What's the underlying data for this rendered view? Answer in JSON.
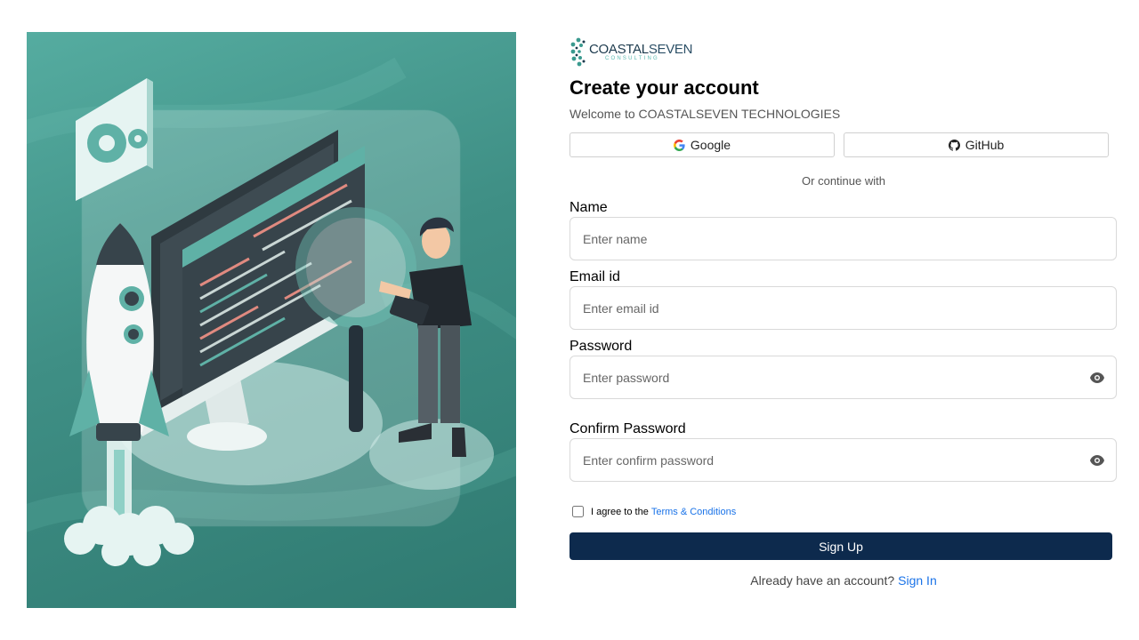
{
  "logo": {
    "main_bold": "COASTAL",
    "main_light": "SEVEN",
    "sub": "CONSULTING"
  },
  "header": {
    "title": "Create your account",
    "subtitle": "Welcome to COASTALSEVEN TECHNOLOGIES"
  },
  "social": {
    "google": "Google",
    "github": "GitHub"
  },
  "divider_text": "Or continue with",
  "fields": {
    "name": {
      "label": "Name",
      "placeholder": "Enter name"
    },
    "email": {
      "label": "Email id",
      "placeholder": "Enter email id"
    },
    "password": {
      "label": "Password",
      "placeholder": "Enter password"
    },
    "confirm": {
      "label": "Confirm Password",
      "placeholder": "Enter confirm password"
    }
  },
  "agree": {
    "prefix": "I agree to the",
    "link": "Terms & Conditions"
  },
  "signup_label": "Sign Up",
  "signin": {
    "prompt": "Already have an account?",
    "link": "Sign In"
  },
  "colors": {
    "primary": "#0d2a4d",
    "link": "#1a73e8",
    "teal": "#4a9e93"
  },
  "icons": [
    "google-icon",
    "github-icon",
    "eye-icon"
  ]
}
